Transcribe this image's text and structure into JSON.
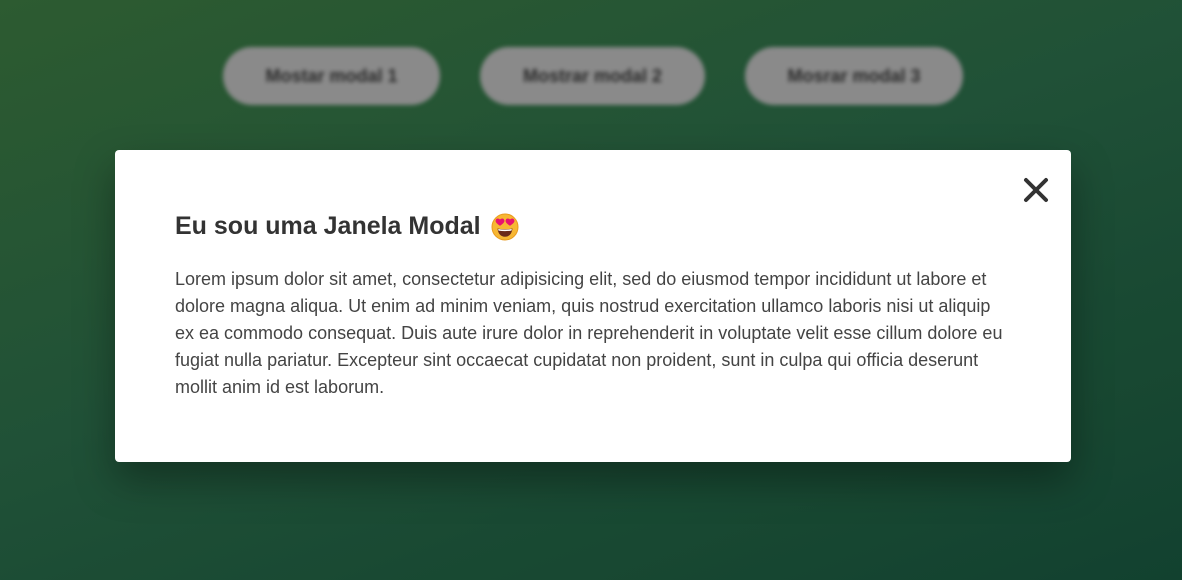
{
  "buttons": [
    {
      "label": "Mostar modal 1"
    },
    {
      "label": "Mostrar modal 2"
    },
    {
      "label": "Mosrar modal 3"
    }
  ],
  "modal": {
    "title": "Eu sou uma Janela Modal",
    "title_emoji_icon": "heart-eyes-emoji-icon",
    "body": "Lorem ipsum dolor sit amet, consectetur adipisicing elit, sed do eiusmod tempor incididunt ut labore et dolore magna aliqua. Ut enim ad minim veniam, quis nostrud exercitation ullamco laboris nisi ut aliquip ex ea commodo consequat. Duis aute irure dolor in reprehenderit in voluptate velit esse cillum dolore eu fugiat nulla pariatur. Excepteur sint occaecat cupidatat non proident, sunt in culpa qui officia deserunt mollit anim id est laborum.",
    "close_icon": "close-icon"
  },
  "colors": {
    "background_start": "#2f5f33",
    "background_end": "#134431",
    "button_bg": "#8a8a8a",
    "modal_bg": "#ffffff",
    "title_text": "#333333",
    "body_text": "#444444"
  }
}
